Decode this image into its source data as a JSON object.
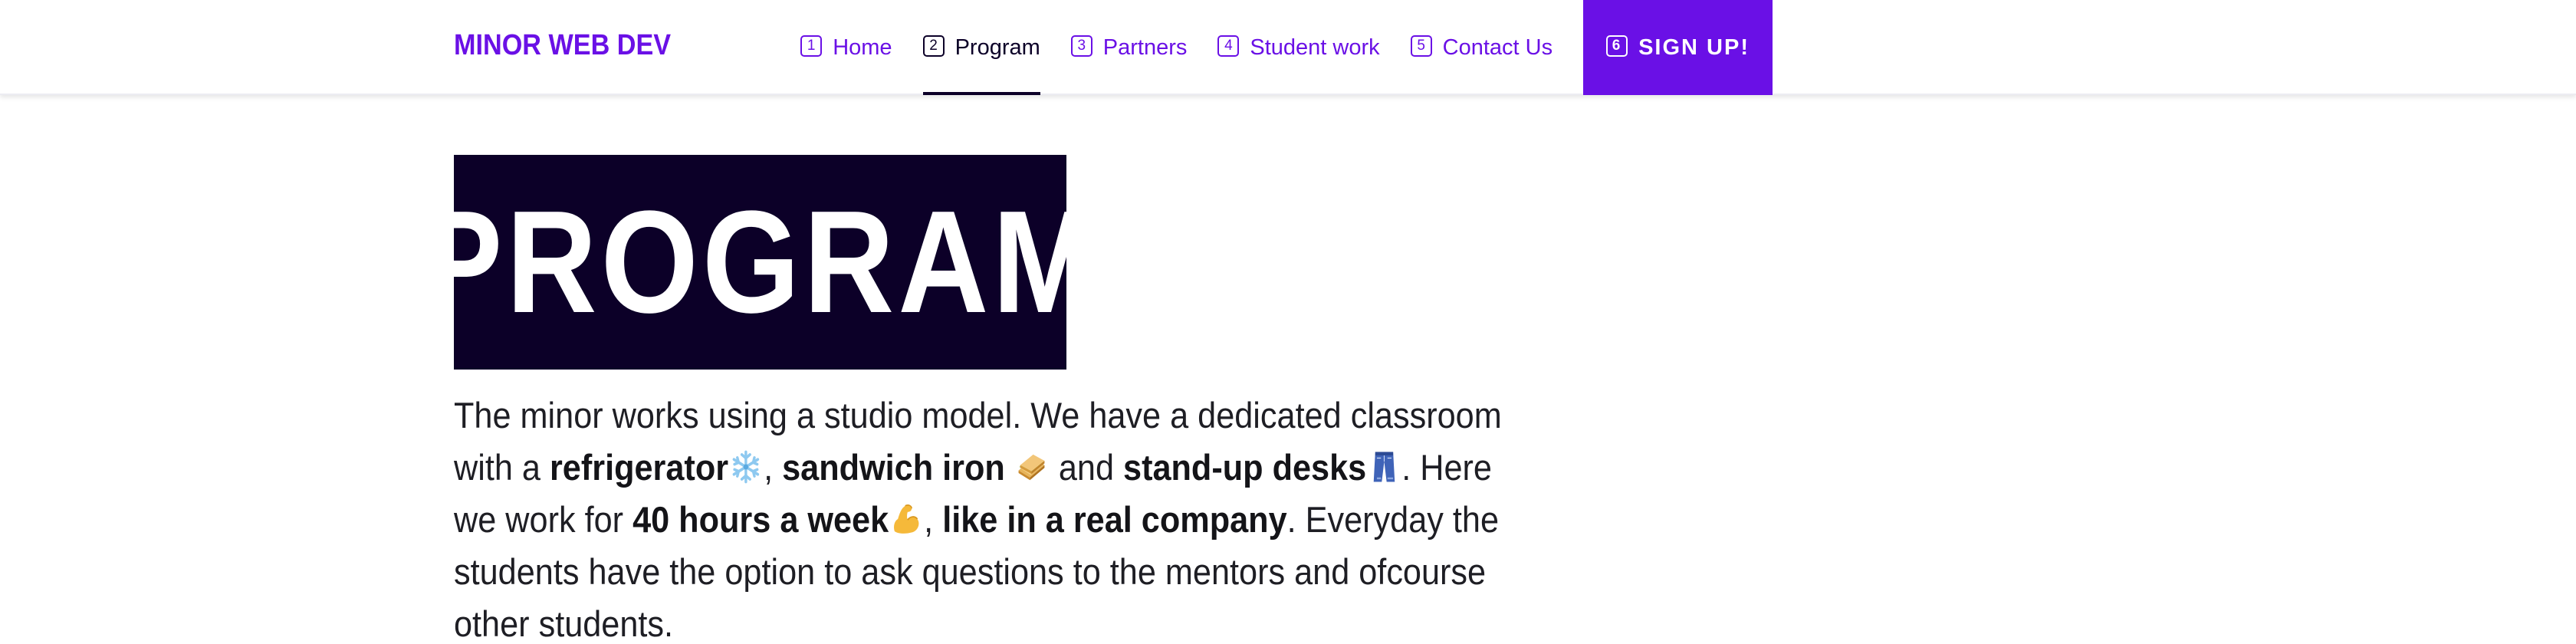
{
  "nav": {
    "brand": "MINOR WEB DEV",
    "items": [
      {
        "key": "1",
        "label": "Home"
      },
      {
        "key": "2",
        "label": "Program"
      },
      {
        "key": "3",
        "label": "Partners"
      },
      {
        "key": "4",
        "label": "Student work"
      },
      {
        "key": "5",
        "label": "Contact Us"
      }
    ],
    "cta": {
      "key": "6",
      "label": "SIGN UP!"
    }
  },
  "hero": {
    "title": "PROGRAM"
  },
  "intro": {
    "t1": "The minor works using a studio model. We have a dedicated classroom with a ",
    "b1": "refrigerator",
    "t2": ", ",
    "b2": "sandwich iron",
    "t3": " and ",
    "b3": "stand-up desks",
    "t4": ". Here we work for ",
    "b4": "40 hours a week",
    "t5": ", ",
    "b5": "like in a real company",
    "t6": ". Everyday the students have the option to ask questions to the mentors and ofcourse other students."
  },
  "icons": {
    "snowflake": "snowflake-icon",
    "sandwich": "sandwich-icon",
    "jeans": "jeans-icon",
    "muscle": "flexed-biceps-icon"
  },
  "colors": {
    "accent": "#6a10e6",
    "dark": "#0c0028",
    "text": "#1e1e24"
  }
}
